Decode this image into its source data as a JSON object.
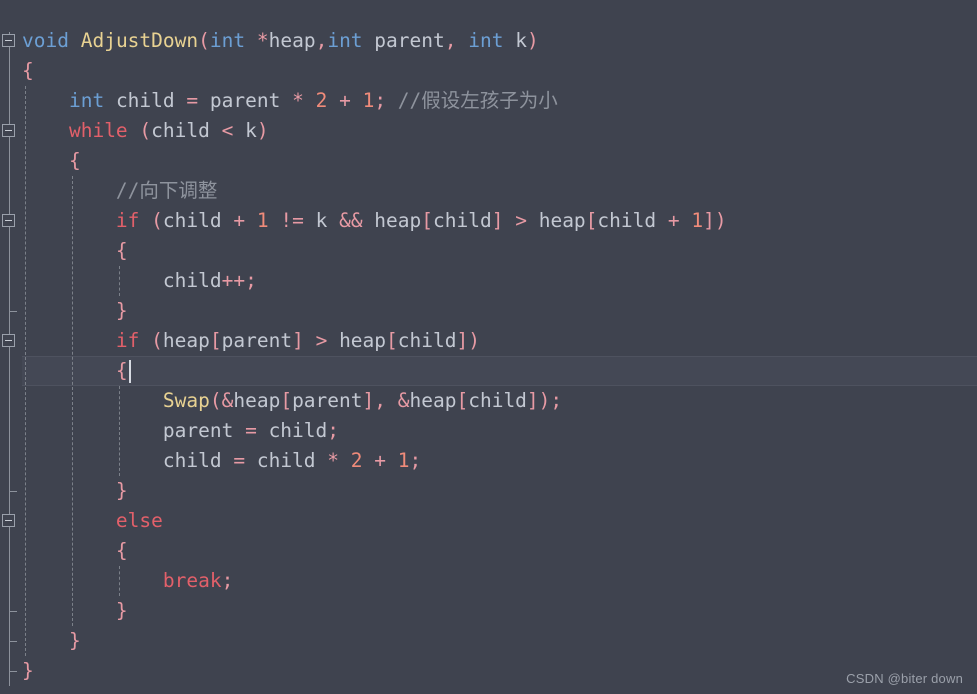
{
  "editor": {
    "background_color": "#3f434f",
    "current_line_color": "#444855",
    "language": "c",
    "caret": {
      "line_index": 11,
      "column_after": "{"
    }
  },
  "colors": {
    "keyword": "#e2606a",
    "type": "#6c9fd4",
    "function": "#e8d292",
    "identifier": "#c3c8d2",
    "punctuation": "#e79aa4",
    "number": "#f08b7a",
    "comment": "#8e939d",
    "gutter_rail": "#8d929c"
  },
  "code_lines": [
    {
      "index": 0,
      "indent": 0,
      "fold": "open",
      "text": "void AdjustDown(int *heap,int parent, int k)",
      "tokens": [
        {
          "t": "void",
          "c": "t-type"
        },
        {
          "t": " ",
          "c": "t-id"
        },
        {
          "t": "AdjustDown",
          "c": "t-fn"
        },
        {
          "t": "(",
          "c": "t-punc"
        },
        {
          "t": "int",
          "c": "t-type"
        },
        {
          "t": " ",
          "c": "t-id"
        },
        {
          "t": "*",
          "c": "t-punc"
        },
        {
          "t": "heap",
          "c": "t-id"
        },
        {
          "t": ",",
          "c": "t-punc"
        },
        {
          "t": "int",
          "c": "t-type"
        },
        {
          "t": " parent",
          "c": "t-id"
        },
        {
          "t": ",",
          "c": "t-punc"
        },
        {
          "t": " ",
          "c": "t-id"
        },
        {
          "t": "int",
          "c": "t-type"
        },
        {
          "t": " k",
          "c": "t-id"
        },
        {
          "t": ")",
          "c": "t-punc"
        }
      ]
    },
    {
      "index": 1,
      "indent": 0,
      "fold": "none",
      "text": "{",
      "tokens": [
        {
          "t": "{",
          "c": "t-brace"
        }
      ]
    },
    {
      "index": 2,
      "indent": 1,
      "fold": "none",
      "text": "    int child = parent * 2 + 1; //假设左孩子为小",
      "tokens": [
        {
          "t": "    ",
          "c": "t-id"
        },
        {
          "t": "int",
          "c": "t-type"
        },
        {
          "t": " child ",
          "c": "t-id"
        },
        {
          "t": "=",
          "c": "t-punc"
        },
        {
          "t": " parent ",
          "c": "t-id"
        },
        {
          "t": "*",
          "c": "t-punc"
        },
        {
          "t": " ",
          "c": "t-id"
        },
        {
          "t": "2",
          "c": "t-num"
        },
        {
          "t": " ",
          "c": "t-id"
        },
        {
          "t": "+",
          "c": "t-punc"
        },
        {
          "t": " ",
          "c": "t-id"
        },
        {
          "t": "1",
          "c": "t-num"
        },
        {
          "t": ";",
          "c": "t-punc"
        },
        {
          "t": " //假设左孩子为小",
          "c": "t-comment"
        }
      ]
    },
    {
      "index": 3,
      "indent": 1,
      "fold": "open",
      "text": "    while (child < k)",
      "tokens": [
        {
          "t": "    ",
          "c": "t-id"
        },
        {
          "t": "while",
          "c": "t-kw"
        },
        {
          "t": " ",
          "c": "t-id"
        },
        {
          "t": "(",
          "c": "t-punc"
        },
        {
          "t": "child ",
          "c": "t-id"
        },
        {
          "t": "<",
          "c": "t-punc"
        },
        {
          "t": " k",
          "c": "t-id"
        },
        {
          "t": ")",
          "c": "t-punc"
        }
      ]
    },
    {
      "index": 4,
      "indent": 1,
      "fold": "none",
      "text": "    {",
      "tokens": [
        {
          "t": "    ",
          "c": "t-id"
        },
        {
          "t": "{",
          "c": "t-brace"
        }
      ]
    },
    {
      "index": 5,
      "indent": 2,
      "fold": "none",
      "text": "        //向下调整",
      "tokens": [
        {
          "t": "        ",
          "c": "t-id"
        },
        {
          "t": "//向下调整",
          "c": "t-comment"
        }
      ]
    },
    {
      "index": 6,
      "indent": 2,
      "fold": "open",
      "text": "        if (child + 1 != k && heap[child] > heap[child + 1])",
      "tokens": [
        {
          "t": "        ",
          "c": "t-id"
        },
        {
          "t": "if",
          "c": "t-kw"
        },
        {
          "t": " ",
          "c": "t-id"
        },
        {
          "t": "(",
          "c": "t-punc"
        },
        {
          "t": "child ",
          "c": "t-id"
        },
        {
          "t": "+",
          "c": "t-punc"
        },
        {
          "t": " ",
          "c": "t-id"
        },
        {
          "t": "1",
          "c": "t-num"
        },
        {
          "t": " ",
          "c": "t-id"
        },
        {
          "t": "!=",
          "c": "t-punc"
        },
        {
          "t": " k ",
          "c": "t-id"
        },
        {
          "t": "&&",
          "c": "t-punc"
        },
        {
          "t": " heap",
          "c": "t-id"
        },
        {
          "t": "[",
          "c": "t-punc"
        },
        {
          "t": "child",
          "c": "t-id"
        },
        {
          "t": "]",
          "c": "t-punc"
        },
        {
          "t": " ",
          "c": "t-id"
        },
        {
          "t": ">",
          "c": "t-punc"
        },
        {
          "t": " heap",
          "c": "t-id"
        },
        {
          "t": "[",
          "c": "t-punc"
        },
        {
          "t": "child ",
          "c": "t-id"
        },
        {
          "t": "+",
          "c": "t-punc"
        },
        {
          "t": " ",
          "c": "t-id"
        },
        {
          "t": "1",
          "c": "t-num"
        },
        {
          "t": "])",
          "c": "t-punc"
        }
      ]
    },
    {
      "index": 7,
      "indent": 2,
      "fold": "none",
      "text": "        {",
      "tokens": [
        {
          "t": "        ",
          "c": "t-id"
        },
        {
          "t": "{",
          "c": "t-brace"
        }
      ]
    },
    {
      "index": 8,
      "indent": 3,
      "fold": "none",
      "text": "            child++;",
      "tokens": [
        {
          "t": "            ",
          "c": "t-id"
        },
        {
          "t": "child",
          "c": "t-id"
        },
        {
          "t": "++;",
          "c": "t-punc"
        }
      ]
    },
    {
      "index": 9,
      "indent": 2,
      "fold": "none",
      "text": "        }",
      "tokens": [
        {
          "t": "        ",
          "c": "t-id"
        },
        {
          "t": "}",
          "c": "t-brace"
        }
      ]
    },
    {
      "index": 10,
      "indent": 2,
      "fold": "open",
      "text": "        if (heap[parent] > heap[child])",
      "tokens": [
        {
          "t": "        ",
          "c": "t-id"
        },
        {
          "t": "if",
          "c": "t-kw"
        },
        {
          "t": " ",
          "c": "t-id"
        },
        {
          "t": "(",
          "c": "t-punc"
        },
        {
          "t": "heap",
          "c": "t-id"
        },
        {
          "t": "[",
          "c": "t-punc"
        },
        {
          "t": "parent",
          "c": "t-id"
        },
        {
          "t": "]",
          "c": "t-punc"
        },
        {
          "t": " ",
          "c": "t-id"
        },
        {
          "t": ">",
          "c": "t-punc"
        },
        {
          "t": " heap",
          "c": "t-id"
        },
        {
          "t": "[",
          "c": "t-punc"
        },
        {
          "t": "child",
          "c": "t-id"
        },
        {
          "t": "])",
          "c": "t-punc"
        }
      ]
    },
    {
      "index": 11,
      "indent": 2,
      "fold": "none",
      "current": true,
      "text": "        {",
      "tokens": [
        {
          "t": "        ",
          "c": "t-id"
        },
        {
          "t": "{",
          "c": "t-brace"
        }
      ]
    },
    {
      "index": 12,
      "indent": 3,
      "fold": "none",
      "text": "            Swap(&heap[parent], &heap[child]);",
      "tokens": [
        {
          "t": "            ",
          "c": "t-id"
        },
        {
          "t": "Swap",
          "c": "t-fn"
        },
        {
          "t": "(&",
          "c": "t-punc"
        },
        {
          "t": "heap",
          "c": "t-id"
        },
        {
          "t": "[",
          "c": "t-punc"
        },
        {
          "t": "parent",
          "c": "t-id"
        },
        {
          "t": "],",
          "c": "t-punc"
        },
        {
          "t": " ",
          "c": "t-id"
        },
        {
          "t": "&",
          "c": "t-punc"
        },
        {
          "t": "heap",
          "c": "t-id"
        },
        {
          "t": "[",
          "c": "t-punc"
        },
        {
          "t": "child",
          "c": "t-id"
        },
        {
          "t": "]);",
          "c": "t-punc"
        }
      ]
    },
    {
      "index": 13,
      "indent": 3,
      "fold": "none",
      "text": "            parent = child;",
      "tokens": [
        {
          "t": "            ",
          "c": "t-id"
        },
        {
          "t": "parent ",
          "c": "t-id"
        },
        {
          "t": "=",
          "c": "t-punc"
        },
        {
          "t": " child",
          "c": "t-id"
        },
        {
          "t": ";",
          "c": "t-punc"
        }
      ]
    },
    {
      "index": 14,
      "indent": 3,
      "fold": "none",
      "text": "            child = child * 2 + 1;",
      "tokens": [
        {
          "t": "            ",
          "c": "t-id"
        },
        {
          "t": "child ",
          "c": "t-id"
        },
        {
          "t": "=",
          "c": "t-punc"
        },
        {
          "t": " child ",
          "c": "t-id"
        },
        {
          "t": "*",
          "c": "t-punc"
        },
        {
          "t": " ",
          "c": "t-id"
        },
        {
          "t": "2",
          "c": "t-num"
        },
        {
          "t": " ",
          "c": "t-id"
        },
        {
          "t": "+",
          "c": "t-punc"
        },
        {
          "t": " ",
          "c": "t-id"
        },
        {
          "t": "1",
          "c": "t-num"
        },
        {
          "t": ";",
          "c": "t-punc"
        }
      ]
    },
    {
      "index": 15,
      "indent": 2,
      "fold": "none",
      "text": "        }",
      "tokens": [
        {
          "t": "        ",
          "c": "t-id"
        },
        {
          "t": "}",
          "c": "t-brace"
        }
      ]
    },
    {
      "index": 16,
      "indent": 2,
      "fold": "open",
      "text": "        else",
      "tokens": [
        {
          "t": "        ",
          "c": "t-id"
        },
        {
          "t": "else",
          "c": "t-kw"
        }
      ]
    },
    {
      "index": 17,
      "indent": 2,
      "fold": "none",
      "text": "        {",
      "tokens": [
        {
          "t": "        ",
          "c": "t-id"
        },
        {
          "t": "{",
          "c": "t-brace"
        }
      ]
    },
    {
      "index": 18,
      "indent": 3,
      "fold": "none",
      "text": "            break;",
      "tokens": [
        {
          "t": "            ",
          "c": "t-id"
        },
        {
          "t": "break",
          "c": "t-kw"
        },
        {
          "t": ";",
          "c": "t-punc"
        }
      ]
    },
    {
      "index": 19,
      "indent": 2,
      "fold": "none",
      "text": "        }",
      "tokens": [
        {
          "t": "        ",
          "c": "t-id"
        },
        {
          "t": "}",
          "c": "t-brace"
        }
      ]
    },
    {
      "index": 20,
      "indent": 1,
      "fold": "none",
      "text": "    }",
      "tokens": [
        {
          "t": "    ",
          "c": "t-id"
        },
        {
          "t": "}",
          "c": "t-brace"
        }
      ]
    },
    {
      "index": 21,
      "indent": 0,
      "fold": "none",
      "text": "}",
      "tokens": [
        {
          "t": "}",
          "c": "t-brace"
        }
      ]
    }
  ],
  "watermark": {
    "text": "CSDN @biter down"
  }
}
